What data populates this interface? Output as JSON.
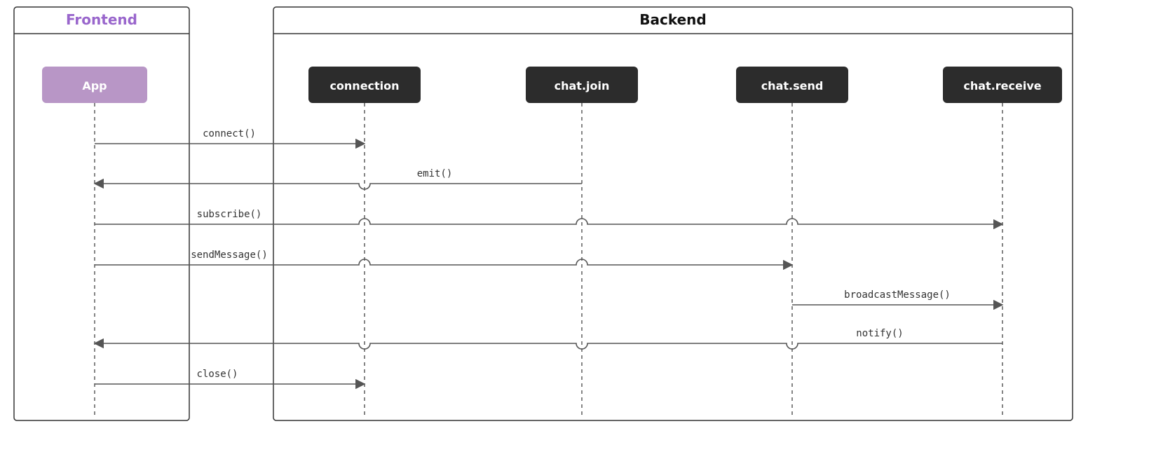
{
  "groups": {
    "frontend": {
      "title": "Frontend",
      "titleColor": "#9966CC"
    },
    "backend": {
      "title": "Backend",
      "titleColor": "#111"
    }
  },
  "actors": {
    "app": {
      "label": "App",
      "bg": "#B896C6"
    },
    "connection": {
      "label": "connection",
      "bg": "#2C2C2C"
    },
    "chatJoin": {
      "label": "chat.join",
      "bg": "#2C2C2C"
    },
    "chatSend": {
      "label": "chat.send",
      "bg": "#2C2C2C"
    },
    "chatReceive": {
      "label": "chat.receive",
      "bg": "#2C2C2C"
    }
  },
  "messages": [
    {
      "label": "connect()",
      "from": "app",
      "to": "connection"
    },
    {
      "label": "emit()",
      "from": "chatJoin",
      "to": "app"
    },
    {
      "label": "subscribe()",
      "from": "app",
      "to": "chatReceive"
    },
    {
      "label": "sendMessage()",
      "from": "app",
      "to": "chatSend"
    },
    {
      "label": "broadcastMessage()",
      "from": "chatSend",
      "to": "chatReceive"
    },
    {
      "label": "notify()",
      "from": "chatReceive",
      "to": "app"
    },
    {
      "label": "close()",
      "from": "app",
      "to": "connection"
    }
  ]
}
